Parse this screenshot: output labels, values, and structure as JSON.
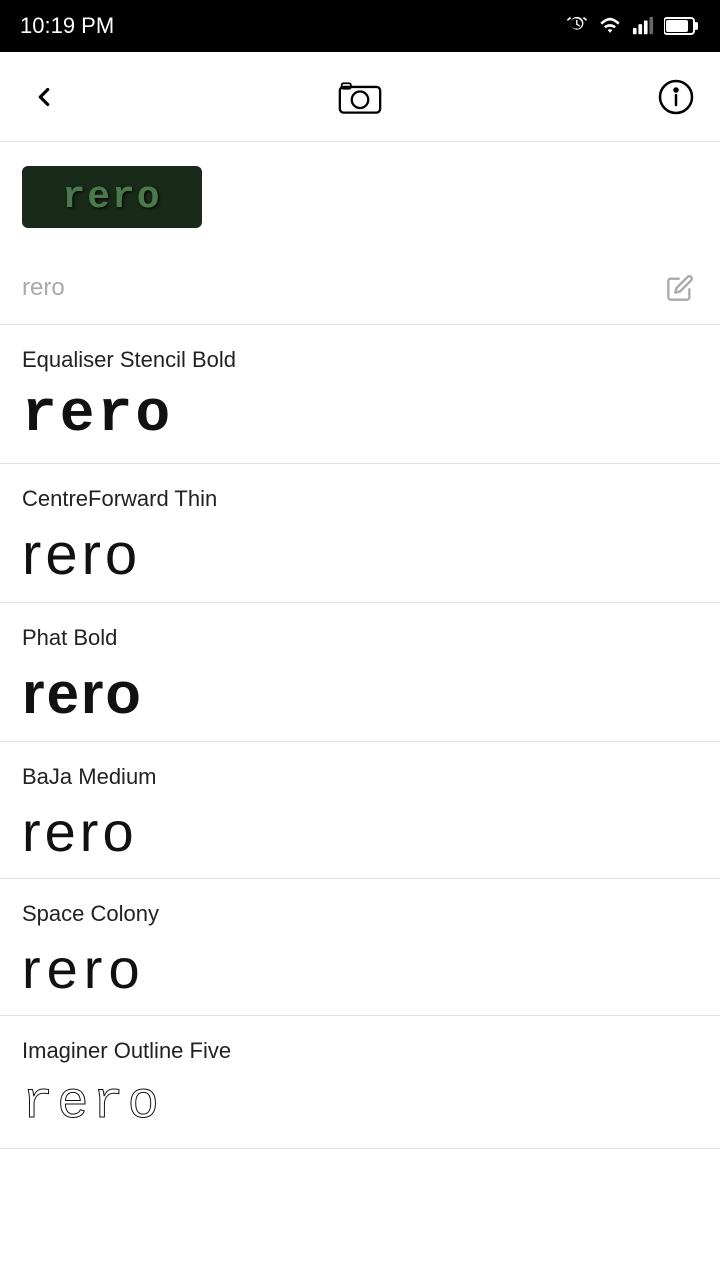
{
  "statusBar": {
    "time": "10:19 PM"
  },
  "topBar": {
    "backLabel": "back",
    "cameraLabel": "camera",
    "infoLabel": "info"
  },
  "preview": {
    "text": "rero"
  },
  "searchRow": {
    "placeholder": "rero",
    "editLabel": "edit"
  },
  "fontList": [
    {
      "name": "Equaliser Stencil Bold",
      "sample": "rero",
      "style": "font-equaliser"
    },
    {
      "name": "CentreForward Thin",
      "sample": "rero",
      "style": "font-centreforward"
    },
    {
      "name": "Phat Bold",
      "sample": "rero",
      "style": "font-phat"
    },
    {
      "name": "BaJa Medium",
      "sample": "rero",
      "style": "font-baja"
    },
    {
      "name": "Space Colony",
      "sample": "rero",
      "style": "font-space"
    },
    {
      "name": "Imaginer Outline Five",
      "sample": "rero",
      "style": "font-imaginer"
    }
  ]
}
